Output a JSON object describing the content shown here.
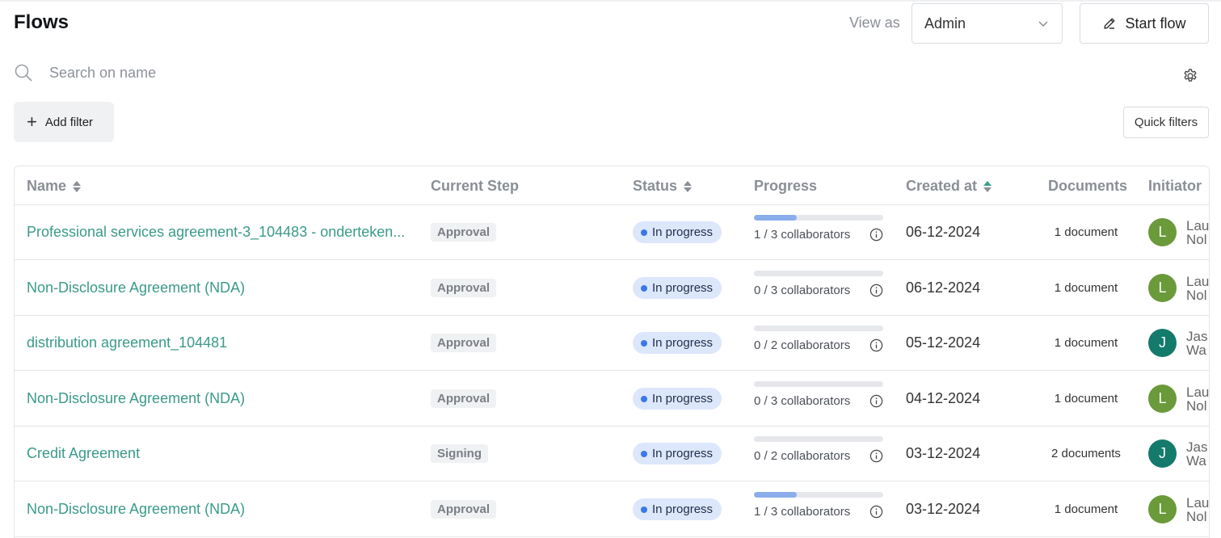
{
  "header": {
    "title": "Flows",
    "view_as_label": "View as",
    "view_as_value": "Admin",
    "start_flow_label": "Start flow"
  },
  "search": {
    "placeholder": "Search on name",
    "value": ""
  },
  "filters": {
    "add_filter_label": "Add filter",
    "quick_filters_label": "Quick filters"
  },
  "table": {
    "columns": {
      "name": "Name",
      "current_step": "Current Step",
      "status": "Status",
      "progress": "Progress",
      "created_at": "Created at",
      "documents": "Documents",
      "initiator": "Initiator"
    },
    "rows": [
      {
        "name": "Professional services agreement-3_104483 - onderteken...",
        "step": "Approval",
        "status": "In progress",
        "progress_text": "1 / 3 collaborators",
        "progress_fraction": 0.333,
        "created": "06-12-2024",
        "documents": "1 document",
        "initiator_initial": "L",
        "initiator_line1": "Lau",
        "initiator_line2": "Nol",
        "avatar_color": "#6a9a3a"
      },
      {
        "name": "Non-Disclosure Agreement (NDA)",
        "step": "Approval",
        "status": "In progress",
        "progress_text": "0 / 3 collaborators",
        "progress_fraction": 0,
        "created": "06-12-2024",
        "documents": "1 document",
        "initiator_initial": "L",
        "initiator_line1": "Lau",
        "initiator_line2": "Nol",
        "avatar_color": "#6a9a3a"
      },
      {
        "name": "distribution agreement_104481",
        "step": "Approval",
        "status": "In progress",
        "progress_text": "0 / 2 collaborators",
        "progress_fraction": 0,
        "created": "05-12-2024",
        "documents": "1 document",
        "initiator_initial": "J",
        "initiator_line1": "Jas",
        "initiator_line2": "Wa",
        "avatar_color": "#147a6c"
      },
      {
        "name": "Non-Disclosure Agreement (NDA)",
        "step": "Approval",
        "status": "In progress",
        "progress_text": "0 / 3 collaborators",
        "progress_fraction": 0,
        "created": "04-12-2024",
        "documents": "1 document",
        "initiator_initial": "L",
        "initiator_line1": "Lau",
        "initiator_line2": "Nol",
        "avatar_color": "#6a9a3a"
      },
      {
        "name": "Credit Agreement",
        "step": "Signing",
        "status": "In progress",
        "progress_text": "0 / 2 collaborators",
        "progress_fraction": 0,
        "created": "03-12-2024",
        "documents": "2 documents",
        "initiator_initial": "J",
        "initiator_line1": "Jas",
        "initiator_line2": "Wa",
        "avatar_color": "#147a6c"
      },
      {
        "name": "Non-Disclosure Agreement (NDA)",
        "step": "Approval",
        "status": "In progress",
        "progress_text": "1 / 3 collaborators",
        "progress_fraction": 0.333,
        "created": "03-12-2024",
        "documents": "1 document",
        "initiator_initial": "L",
        "initiator_line1": "Lau",
        "initiator_line2": "Nol",
        "avatar_color": "#6a9a3a"
      }
    ]
  },
  "icons": {
    "search": "search-icon",
    "settings": "gear-icon",
    "start_flow": "pencil-icon",
    "dropdown": "chevron-down-icon",
    "info": "info-icon",
    "sort": "sort-icon"
  },
  "colors": {
    "link": "#3a9a8a",
    "status_bg": "#dce7fb",
    "status_dot": "#3b78e7",
    "progress_fill": "#8aaeeb"
  }
}
